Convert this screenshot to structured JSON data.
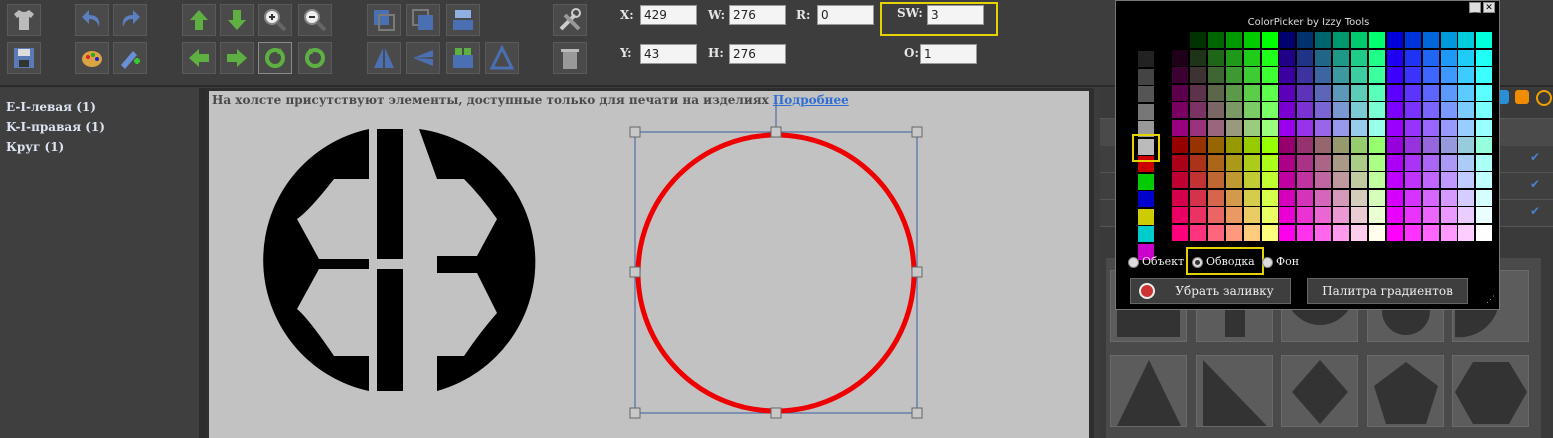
{
  "toolbar": {
    "icons": [
      "tshirt-icon",
      "undo-icon",
      "redo-icon",
      "move-up-icon",
      "move-down-icon",
      "zoom-in-icon",
      "zoom-out-icon",
      "layer-front-icon",
      "layer-back-icon",
      "align-icon",
      "settings-tools-icon",
      "save-icon",
      "palette-icon",
      "add-image-icon",
      "move-left-icon",
      "move-right-icon",
      "rotate-cw-icon",
      "rotate-ccw-icon",
      "flip-h-icon",
      "flip-h2-icon",
      "flip-v-icon",
      "flip-v2-icon",
      "trash-icon"
    ]
  },
  "props": {
    "x_label": "X:",
    "x_value": "429",
    "w_label": "W:",
    "w_value": "276",
    "r_label": "R:",
    "r_value": "0",
    "sw_label": "SW:",
    "sw_value": "3",
    "y_label": "Y:",
    "y_value": "43",
    "h_label": "H:",
    "h_value": "276",
    "o_label": "O:",
    "o_value": "1"
  },
  "layers": [
    "E-I-левая (1)",
    "K-I-правая (1)",
    "Круг (1)"
  ],
  "canvas": {
    "notice": "На холсте присутствуют элементы, доступные только для печати на изделиях",
    "notice_link": "Подробнее",
    "circle_stroke": "#ee0000"
  },
  "picker": {
    "title": "ColorPicker by Izzy Tools",
    "radio_object": "Объект",
    "radio_stroke": "Обводка",
    "radio_background": "Фон",
    "selected": "stroke",
    "remove_fill": "Убрать заливку",
    "gradients": "Палитра градиентов",
    "selected_color": "#cc0000"
  },
  "colors": {
    "highlight": "#e4d300",
    "toolbar_bg": "#3d3d3d",
    "canvas_bg": "#c2c2c2"
  }
}
